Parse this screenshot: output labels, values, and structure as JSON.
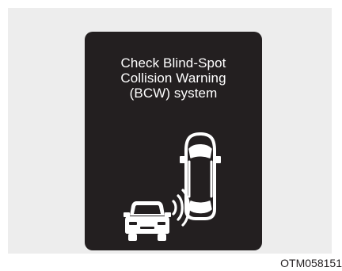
{
  "display": {
    "message_lines": [
      "Check Blind-Spot",
      "Collision Warning",
      "(BCW) system"
    ]
  },
  "caption": "OTM058151",
  "icons": {
    "own_vehicle": "car-rear-view-icon",
    "detected_vehicle": "car-front-view-icon",
    "sensor_waves": "radar-wave-icon"
  },
  "colors": {
    "display_background": "#231f20",
    "display_foreground": "#ffffff",
    "panel_background": "#ededed"
  }
}
